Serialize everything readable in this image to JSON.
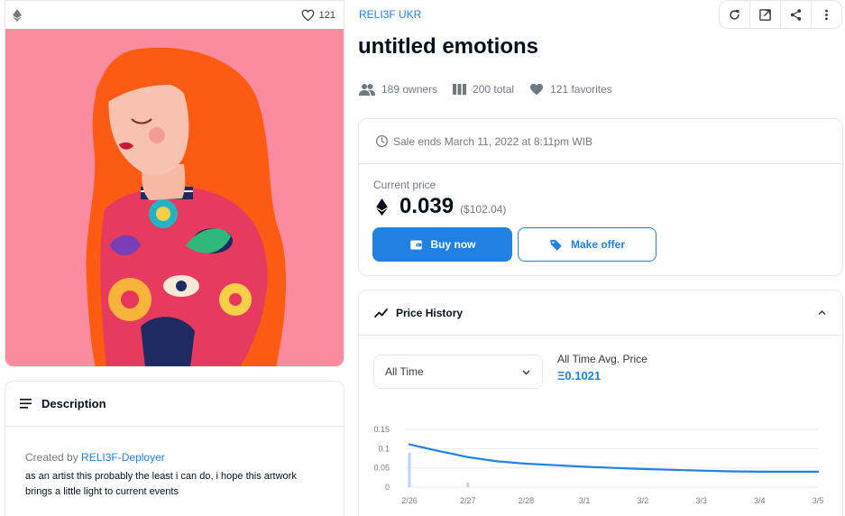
{
  "item": {
    "collection": "RELI3F UKR",
    "title": "untitled emotions",
    "image_favorites": "121"
  },
  "stats": {
    "owners": "189 owners",
    "total": "200 total",
    "favorites": "121 favorites"
  },
  "sale": {
    "ends": "Sale ends March 11, 2022 at 8:11pm WIB",
    "current_price_label": "Current price",
    "price": "0.039",
    "price_usd": "($102.04)",
    "buy_label": "Buy now",
    "offer_label": "Make offer"
  },
  "description": {
    "header": "Description",
    "created_by_prefix": "Created by",
    "creator": "RELI3F-Deployer",
    "text": "as an artist this probably the least i can do, i hope this artwork brings a little light to current events"
  },
  "history": {
    "header": "Price History",
    "filter_value": "All Time",
    "avg_label": "All Time Avg. Price",
    "avg_value": "Ξ0.1021"
  },
  "colors": {
    "accent": "#2081e2",
    "artwork_bg": "#fb8ca0"
  },
  "icons": [
    "ethereum-icon",
    "heart-outline-icon",
    "refresh-icon",
    "external-link-icon",
    "share-icon",
    "more-vert-icon",
    "owners-icon",
    "grid-icon",
    "heart-icon",
    "clock-icon",
    "wallet-icon",
    "tag-icon",
    "lines-icon",
    "trending-icon",
    "chevron-up-icon",
    "chevron-down-icon"
  ],
  "chart_data": {
    "type": "line",
    "categories": [
      "2/26",
      "2/27",
      "2/28",
      "3/1",
      "3/2",
      "3/3",
      "3/4",
      "3/5"
    ],
    "y_ticks": [
      "0.15",
      "0.1",
      "0.05",
      "0"
    ],
    "ylim": [
      0,
      0.15
    ],
    "series": [
      {
        "x": [
          0,
          0.2,
          0.5,
          1,
          1.5,
          2,
          2.5,
          3,
          3.5,
          4,
          4.5,
          5,
          5.5,
          6,
          6.5,
          7
        ],
        "values": [
          0.111,
          0.104,
          0.094,
          0.078,
          0.067,
          0.061,
          0.057,
          0.053,
          0.05,
          0.047,
          0.045,
          0.043,
          0.041,
          0.04,
          0.04,
          0.04
        ]
      }
    ],
    "volume_bars": [
      {
        "x": 0,
        "value": 0.09
      },
      {
        "x": 1,
        "value": 0.012
      }
    ],
    "grid": true
  }
}
